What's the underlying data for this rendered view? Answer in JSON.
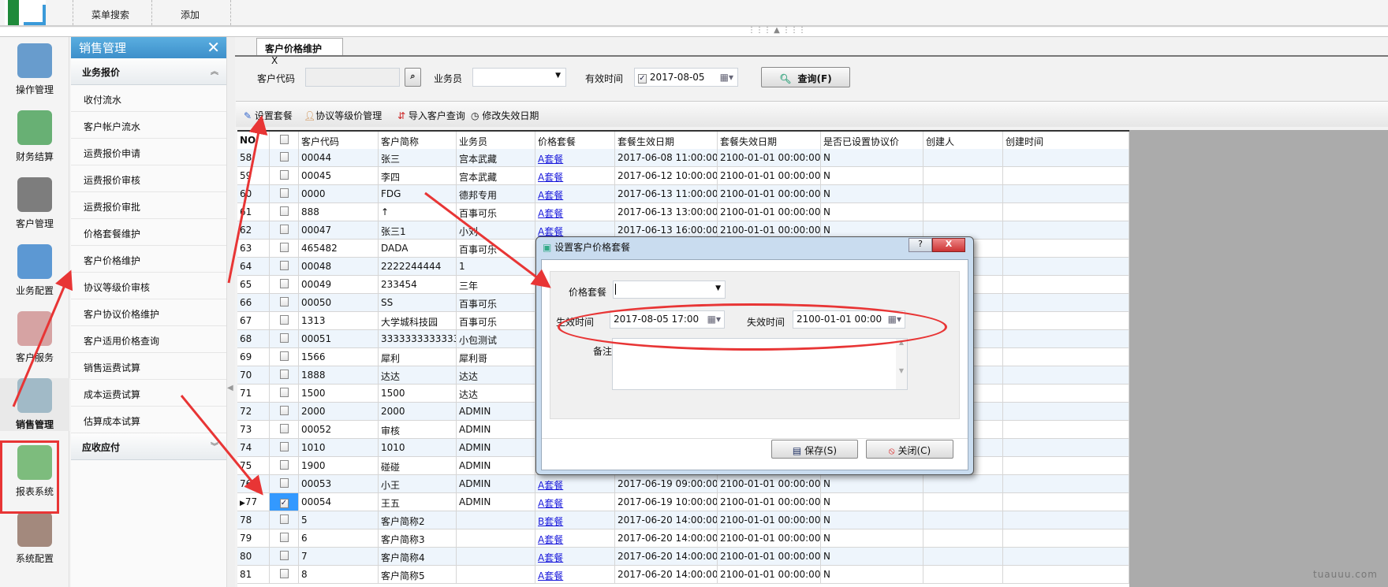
{
  "toolbar": {
    "menu_search": "菜单搜索",
    "add": "添加"
  },
  "iconbar": [
    "操作管理",
    "财务结算",
    "客户管理",
    "业务配置",
    "客户服务",
    "销售管理",
    "报表系统",
    "系统配置"
  ],
  "menu": {
    "title": "销售管理",
    "group1": "业务报价",
    "items": [
      "收付流水",
      "客户帐户流水",
      "运费报价申请",
      "运费报价审核",
      "运费报价审批",
      "价格套餐维护",
      "客户价格维护",
      "协议等级价审核",
      "客户协议价格维护",
      "客户适用价格查询",
      "销售运费试算",
      "成本运费试算",
      "估算成本试算"
    ],
    "group2": "应收应付"
  },
  "tab": {
    "label": "客户价格维护",
    "close": "X"
  },
  "filters": {
    "customer_code_label": "客户代码",
    "customer_code": "",
    "salesman_label": "业务员",
    "salesman": "",
    "valid_time_label": "有效时间",
    "valid_time": "2017-08-05",
    "valid_checked": true,
    "query": "查询(F)"
  },
  "actions": [
    "设置套餐",
    "协议等级价管理",
    "导入客户查询",
    "修改失效日期"
  ],
  "grid": {
    "columns": [
      "NO",
      "",
      "客户代码",
      "客户简称",
      "业务员",
      "价格套餐",
      "套餐生效日期",
      "套餐失效日期",
      "是否已设置协议价",
      "创建人",
      "创建时间"
    ],
    "rows": [
      [
        "58",
        false,
        "00044",
        "张三",
        "宫本武藏",
        "A套餐",
        "2017-06-08 11:00:00",
        "2100-01-01 00:00:00",
        "N",
        "",
        ""
      ],
      [
        "59",
        false,
        "00045",
        "李四",
        "宫本武藏",
        "A套餐",
        "2017-06-12 10:00:00",
        "2100-01-01 00:00:00",
        "N",
        "",
        ""
      ],
      [
        "60",
        false,
        "0000",
        "FDG",
        "德邦专用",
        "A套餐",
        "2017-06-13 11:00:00",
        "2100-01-01 00:00:00",
        "N",
        "",
        ""
      ],
      [
        "61",
        false,
        "888",
        "↑",
        "百事可乐",
        "A套餐",
        "2017-06-13 13:00:00",
        "2100-01-01 00:00:00",
        "N",
        "",
        ""
      ],
      [
        "62",
        false,
        "00047",
        "张三1",
        "小刘",
        "A套餐",
        "2017-06-13 16:00:00",
        "2100-01-01 00:00:00",
        "N",
        "",
        ""
      ],
      [
        "63",
        false,
        "465482",
        "DADA",
        "百事可乐",
        "",
        "",
        "",
        "",
        "",
        ""
      ],
      [
        "64",
        false,
        "00048",
        "2222244444",
        "1",
        "",
        "",
        "",
        "",
        "",
        ""
      ],
      [
        "65",
        false,
        "00049",
        "233454",
        "三年",
        "",
        "",
        "",
        "",
        "",
        ""
      ],
      [
        "66",
        false,
        "00050",
        "SS",
        "百事可乐",
        "",
        "",
        "",
        "",
        "",
        ""
      ],
      [
        "67",
        false,
        "1313",
        "大学城科技园",
        "百事可乐",
        "",
        "",
        "",
        "",
        "",
        ""
      ],
      [
        "68",
        false,
        "00051",
        "3333333333333",
        "小包测试",
        "",
        "",
        "",
        "",
        "",
        ""
      ],
      [
        "69",
        false,
        "1566",
        "犀利",
        "犀利哥",
        "",
        "",
        "",
        "",
        "",
        ""
      ],
      [
        "70",
        false,
        "1888",
        "达达",
        "达达",
        "",
        "",
        "",
        "",
        "",
        ""
      ],
      [
        "71",
        false,
        "1500",
        "1500",
        "达达",
        "",
        "",
        "",
        "",
        "",
        ""
      ],
      [
        "72",
        false,
        "2000",
        "2000",
        "ADMIN",
        "",
        "",
        "",
        "",
        "",
        ""
      ],
      [
        "73",
        false,
        "00052",
        "审核",
        "ADMIN",
        "",
        "",
        "",
        "",
        "",
        ""
      ],
      [
        "74",
        false,
        "1010",
        "1010",
        "ADMIN",
        "",
        "",
        "",
        "",
        "",
        ""
      ],
      [
        "75",
        false,
        "1900",
        "碰碰",
        "ADMIN",
        "",
        "",
        "",
        "",
        "",
        ""
      ],
      [
        "76",
        false,
        "00053",
        "小王",
        "ADMIN",
        "A套餐",
        "2017-06-19 09:00:00",
        "2100-01-01 00:00:00",
        "N",
        "",
        ""
      ],
      [
        "77",
        true,
        "00054",
        "王五",
        "ADMIN",
        "A套餐",
        "2017-06-19 10:00:00",
        "2100-01-01 00:00:00",
        "N",
        "",
        ""
      ],
      [
        "78",
        false,
        "5",
        "客户简称2",
        "",
        "B套餐",
        "2017-06-20 14:00:00",
        "2100-01-01 00:00:00",
        "N",
        "",
        ""
      ],
      [
        "79",
        false,
        "6",
        "客户简称3",
        "",
        "A套餐",
        "2017-06-20 14:00:00",
        "2100-01-01 00:00:00",
        "N",
        "",
        ""
      ],
      [
        "80",
        false,
        "7",
        "客户简称4",
        "",
        "A套餐",
        "2017-06-20 14:00:00",
        "2100-01-01 00:00:00",
        "N",
        "",
        ""
      ],
      [
        "81",
        false,
        "8",
        "客户简称5",
        "",
        "A套餐",
        "2017-06-20 14:00:00",
        "2100-01-01 00:00:00",
        "N",
        "",
        ""
      ]
    ],
    "selected_row": "77"
  },
  "dialog": {
    "title": "设置客户价格套餐",
    "help": "?",
    "close": "X",
    "package_label": "价格套餐",
    "package": "",
    "effective_label": "生效时间",
    "effective": "2017-08-05 17:00",
    "expire_label": "失效时间",
    "expire": "2100-01-01 00:00",
    "remark_label": "备注",
    "remark": "",
    "save": "保存(S)",
    "cancel": "关闭(C)"
  },
  "watermark": "tuauuu.com",
  "colors": {
    "accent": "#3d8fca",
    "annotation": "#e83535",
    "row_alt": "#eef5fc",
    "selected": "#3399ff"
  }
}
